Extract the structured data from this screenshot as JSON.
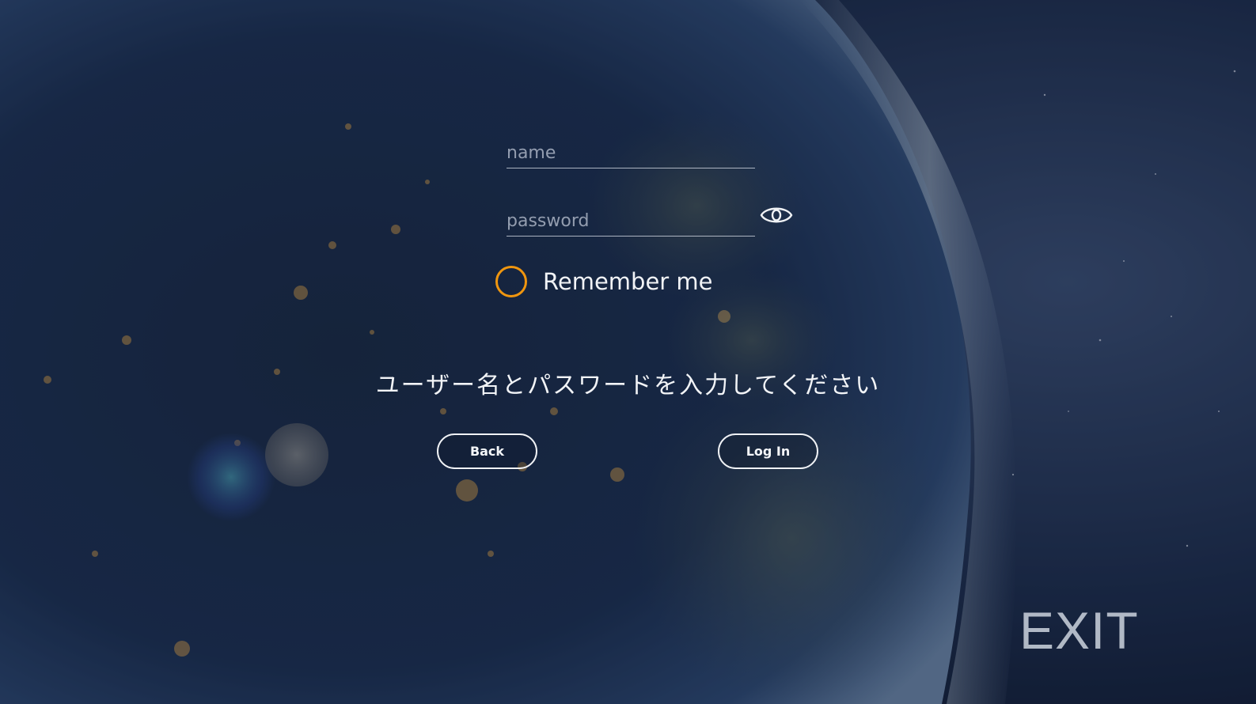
{
  "login_form": {
    "name_placeholder": "name",
    "password_placeholder": "password",
    "show_password_icon": "eye-icon",
    "remember_me_label": "Remember me",
    "remember_me_checked": false,
    "accent_color": "#f0960f"
  },
  "message": "ユーザー名とパスワードを入力してください",
  "buttons": {
    "back_label": "Back",
    "login_label": "Log In"
  },
  "exit_label": "EXIT"
}
